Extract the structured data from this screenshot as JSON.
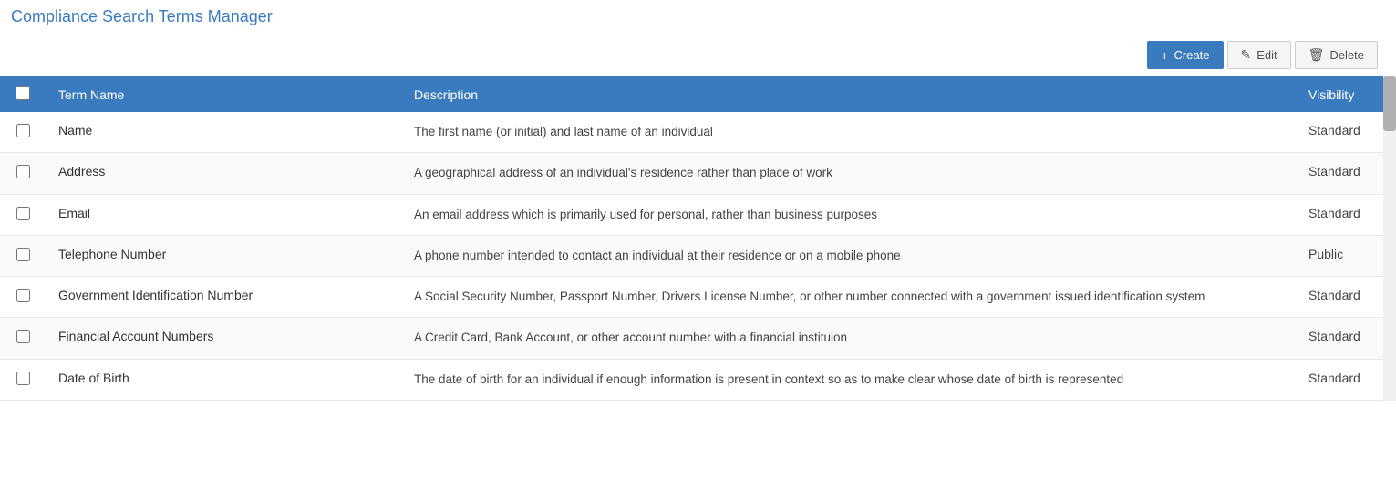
{
  "title": "Compliance Search Terms Manager",
  "toolbar": {
    "create_label": "Create",
    "edit_label": "Edit",
    "delete_label": "Delete"
  },
  "table": {
    "columns": {
      "checkbox": "",
      "term_name": "Term Name",
      "description": "Description",
      "visibility": "Visibility"
    },
    "rows": [
      {
        "term_name": "Name",
        "description": "The first name (or initial) and last name of an individual",
        "visibility": "Standard"
      },
      {
        "term_name": "Address",
        "description": "A geographical address of an individual's residence rather than place of work",
        "visibility": "Standard"
      },
      {
        "term_name": "Email",
        "description": "An email address which is primarily used for personal, rather than business purposes",
        "visibility": "Standard"
      },
      {
        "term_name": "Telephone Number",
        "description": "A phone number intended to contact an individual at their residence or on a mobile phone",
        "visibility": "Public"
      },
      {
        "term_name": "Government Identification Number",
        "description": "A Social Security Number, Passport Number, Drivers License Number, or other number connected with a government issued identification system",
        "visibility": "Standard"
      },
      {
        "term_name": "Financial Account Numbers",
        "description": "A Credit Card, Bank Account, or other account number with a financial instituion",
        "visibility": "Standard"
      },
      {
        "term_name": "Date of Birth",
        "description": "The date of birth for an individual if enough information is present in context so as to make clear whose date of birth is represented",
        "visibility": "Standard"
      }
    ]
  }
}
